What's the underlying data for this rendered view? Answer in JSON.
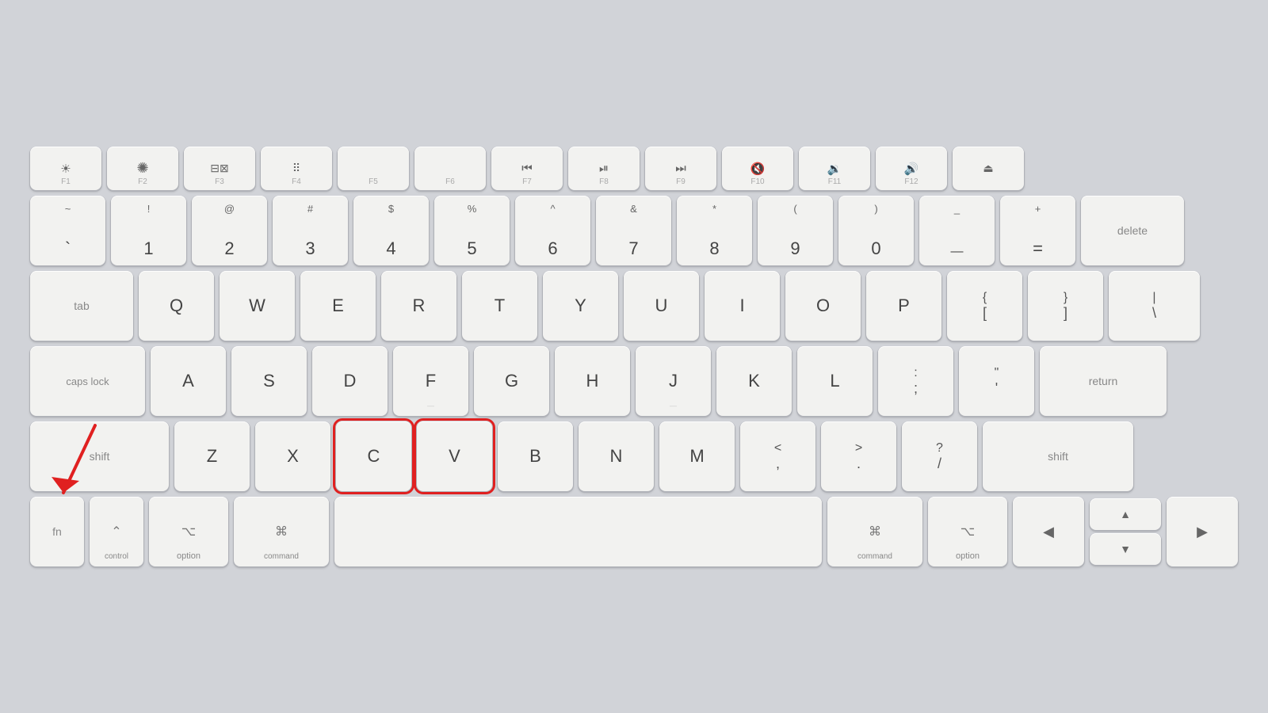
{
  "keyboard": {
    "background_color": "#d1d3d8",
    "rows": {
      "fn_row": {
        "keys": [
          {
            "id": "f1",
            "icon": "☀",
            "label": "F1",
            "type": "fn"
          },
          {
            "id": "f2",
            "icon": "✺",
            "label": "F2",
            "type": "fn"
          },
          {
            "id": "f3",
            "icon": "⊞",
            "label": "F3",
            "type": "fn"
          },
          {
            "id": "f4",
            "icon": "⠿",
            "label": "F4",
            "type": "fn"
          },
          {
            "id": "f5",
            "icon": "",
            "label": "F5",
            "type": "fn"
          },
          {
            "id": "f6",
            "icon": "",
            "label": "F6",
            "type": "fn"
          },
          {
            "id": "f7",
            "icon": "«",
            "label": "F7",
            "type": "fn"
          },
          {
            "id": "f8",
            "icon": "▶⏸",
            "label": "F8",
            "type": "fn"
          },
          {
            "id": "f9",
            "icon": "»",
            "label": "F9",
            "type": "fn"
          },
          {
            "id": "f10",
            "icon": "◁",
            "label": "F10",
            "type": "fn"
          },
          {
            "id": "f11",
            "icon": "◁◁",
            "label": "F11",
            "type": "fn"
          },
          {
            "id": "f12",
            "icon": "◁◁◁",
            "label": "F12",
            "type": "fn"
          },
          {
            "id": "power",
            "icon": "⏏",
            "label": "",
            "type": "fn"
          }
        ]
      },
      "num_row": {
        "keys": [
          {
            "id": "backtick",
            "top": "~",
            "bot": "`"
          },
          {
            "id": "1",
            "top": "!",
            "bot": "1"
          },
          {
            "id": "2",
            "top": "@",
            "bot": "2"
          },
          {
            "id": "3",
            "top": "#",
            "bot": "3"
          },
          {
            "id": "4",
            "top": "$",
            "bot": "4"
          },
          {
            "id": "5",
            "top": "%",
            "bot": "5"
          },
          {
            "id": "6",
            "top": "^",
            "bot": "6"
          },
          {
            "id": "7",
            "top": "&",
            "bot": "7"
          },
          {
            "id": "8",
            "top": "*",
            "bot": "8"
          },
          {
            "id": "9",
            "top": "(",
            "bot": "9"
          },
          {
            "id": "0",
            "top": ")",
            "bot": "0"
          },
          {
            "id": "minus",
            "top": "_",
            "bot": "—"
          },
          {
            "id": "equal",
            "top": "+",
            "bot": "="
          },
          {
            "id": "delete",
            "label": "delete",
            "type": "wide"
          }
        ]
      },
      "qwerty_row": {
        "keys": [
          "Q",
          "W",
          "E",
          "R",
          "T",
          "Y",
          "U",
          "I",
          "O",
          "P",
          {
            "id": "bracket_open",
            "top": "{",
            "bot": "["
          },
          {
            "id": "bracket_close",
            "top": "}",
            "bot": "]"
          },
          {
            "id": "backslash",
            "top": "|",
            "bot": "\\"
          }
        ]
      },
      "asdf_row": {
        "keys": [
          "A",
          "S",
          "D",
          "F",
          "G",
          "H",
          "J",
          "K",
          "L",
          {
            "id": "semicolon",
            "top": ":",
            "bot": ";"
          },
          {
            "id": "quote",
            "top": "\"",
            "bot": "'"
          },
          {
            "id": "return",
            "label": "return",
            "type": "wide"
          }
        ]
      },
      "zxcv_row": {
        "keys": [
          "Z",
          "X",
          "C",
          "V",
          "B",
          "N",
          "M",
          {
            "id": "comma",
            "top": "<",
            "bot": ","
          },
          {
            "id": "period",
            "top": ">",
            "bot": "."
          },
          {
            "id": "slash",
            "top": "?",
            "bot": "/"
          },
          {
            "id": "shift_r",
            "label": "shift",
            "type": "wide"
          }
        ]
      },
      "bottom_row": {
        "keys": [
          {
            "id": "fn",
            "label": "fn",
            "type": "fn-key"
          },
          {
            "id": "ctrl",
            "label": "control",
            "icon": "⌃",
            "type": "modifier"
          },
          {
            "id": "option_l",
            "label": "option",
            "icon": "⌥",
            "type": "modifier"
          },
          {
            "id": "cmd_l",
            "label": "command",
            "icon": "⌘",
            "type": "modifier"
          },
          {
            "id": "space",
            "label": "",
            "type": "space"
          },
          {
            "id": "cmd_r",
            "label": "command",
            "icon": "⌘",
            "type": "modifier"
          },
          {
            "id": "option_r",
            "label": "option",
            "icon": "⌥",
            "type": "modifier"
          },
          {
            "id": "arrow_left",
            "label": "◀",
            "type": "arrow"
          },
          {
            "id": "arrow_up",
            "label": "▲",
            "type": "arrow"
          },
          {
            "id": "arrow_down",
            "label": "▼",
            "type": "arrow"
          },
          {
            "id": "arrow_right",
            "label": "▶",
            "type": "arrow"
          }
        ]
      }
    },
    "highlighted_keys": [
      "C",
      "V"
    ],
    "arrow_annotation": {
      "color": "#e02020",
      "points_to": "option_l"
    }
  }
}
